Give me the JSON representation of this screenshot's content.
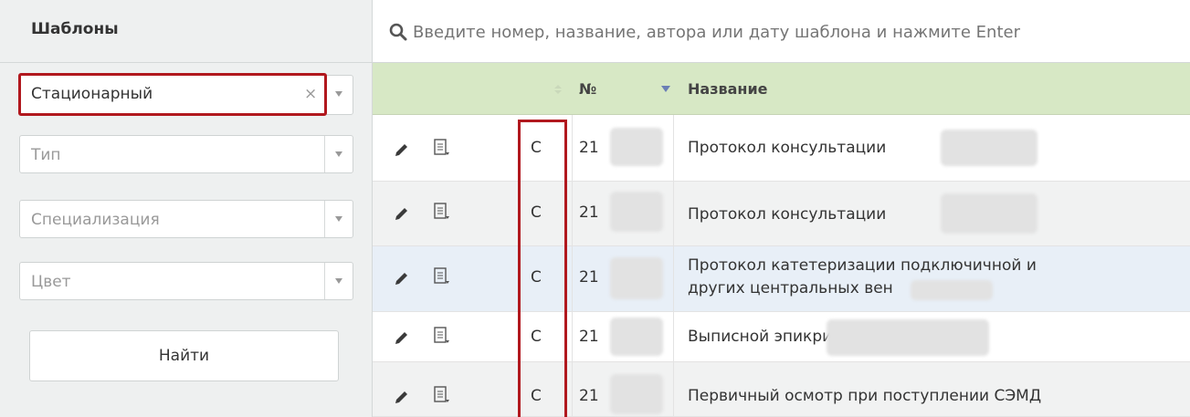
{
  "sidebar": {
    "title": "Шаблоны",
    "filters": {
      "category": {
        "value": "Стационарный",
        "clear": "×"
      },
      "type": {
        "placeholder": "Тип"
      },
      "specialization": {
        "placeholder": "Специализация"
      },
      "color": {
        "placeholder": "Цвет"
      }
    },
    "find_label": "Найти"
  },
  "search": {
    "placeholder": "Введите номер, название, автора или дату шаблона и нажмите Enter"
  },
  "table": {
    "columns": {
      "number": "№",
      "name": "Название"
    },
    "rows": [
      {
        "type": "С",
        "number": "21",
        "name": "Протокол консультации",
        "icons": [
          "pencil-icon",
          "document-icon"
        ]
      },
      {
        "type": "С",
        "number": "21",
        "name": "Протокол консультации",
        "icons": [
          "pencil-icon",
          "document-icon"
        ]
      },
      {
        "type": "С",
        "number": "21",
        "name_line1": "Протокол катетеризации подключичной и",
        "name_line2": "других центральных вен",
        "icons": [
          "pencil-icon",
          "document-icon"
        ]
      },
      {
        "type": "С",
        "number": "21",
        "name": "Выписной эпикриз",
        "icons": [
          "pencil-icon",
          "document-icon"
        ]
      },
      {
        "type": "С",
        "number": "21",
        "name": "Первичный осмотр при поступлении СЭМД",
        "icons": [
          "pencil-icon",
          "document-icon"
        ]
      }
    ]
  },
  "colors": {
    "highlight": "#b1181e",
    "header_bg": "#d7e8c5",
    "selected_row": "#e8eff7"
  }
}
